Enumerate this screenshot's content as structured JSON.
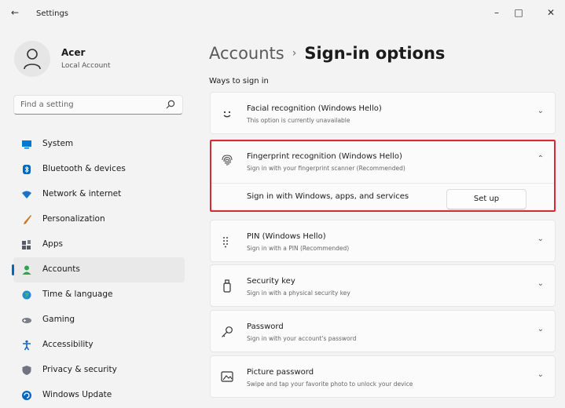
{
  "window": {
    "title": "Settings",
    "back_glyph": "←",
    "minimize_glyph": "–",
    "maximize_glyph": "□",
    "close_glyph": "✕"
  },
  "user": {
    "name": "Acer",
    "account_type": "Local Account"
  },
  "search": {
    "placeholder": "Find a setting"
  },
  "sidebar": {
    "items": [
      {
        "label": "System",
        "icon": "system-icon",
        "color": "#0078d4"
      },
      {
        "label": "Bluetooth & devices",
        "icon": "bluetooth-icon",
        "color": "#0067c0"
      },
      {
        "label": "Network & internet",
        "icon": "wifi-icon",
        "color": "#1a73c9"
      },
      {
        "label": "Personalization",
        "icon": "brush-icon",
        "color": "#c87d2c"
      },
      {
        "label": "Apps",
        "icon": "apps-icon",
        "color": "#555a66"
      },
      {
        "label": "Accounts",
        "icon": "accounts-icon",
        "color": "#2ea44f",
        "selected": true
      },
      {
        "label": "Time & language",
        "icon": "globe-icon",
        "color": "#1f8ad6"
      },
      {
        "label": "Gaming",
        "icon": "gamepad-icon",
        "color": "#7a7f8a"
      },
      {
        "label": "Accessibility",
        "icon": "accessibility-icon",
        "color": "#1565c0"
      },
      {
        "label": "Privacy & security",
        "icon": "shield-icon",
        "color": "#6f7480"
      },
      {
        "label": "Windows Update",
        "icon": "update-icon",
        "color": "#0067c0"
      }
    ]
  },
  "header": {
    "breadcrumb_parent": "Accounts",
    "separator": "›",
    "page_title": "Sign-in options"
  },
  "section_title": "Ways to sign in",
  "options": [
    {
      "title": "Facial recognition (Windows Hello)",
      "subtitle": "This option is currently unavailable",
      "icon": "face-icon",
      "chevron": "⌄"
    },
    {
      "title": "Fingerprint recognition (Windows Hello)",
      "subtitle": "Sign in with your fingerprint scanner (Recommended)",
      "icon": "fingerprint-icon",
      "chevron": "⌃",
      "expanded": true,
      "expanded_label": "Sign in with Windows, apps, and services",
      "button_label": "Set up"
    },
    {
      "title": "PIN (Windows Hello)",
      "subtitle": "Sign in with a PIN (Recommended)",
      "icon": "pin-keypad-icon",
      "chevron": "⌄"
    },
    {
      "title": "Security key",
      "subtitle": "Sign in with a physical security key",
      "icon": "security-key-icon",
      "chevron": "⌄"
    },
    {
      "title": "Password",
      "subtitle": "Sign in with your account's password",
      "icon": "key-icon",
      "chevron": "⌄"
    },
    {
      "title": "Picture password",
      "subtitle": "Swipe and tap your favorite photo to unlock your device",
      "icon": "picture-icon",
      "chevron": "⌄"
    }
  ],
  "highlight_color": "#d62b35",
  "accent_color": "#0067c0"
}
